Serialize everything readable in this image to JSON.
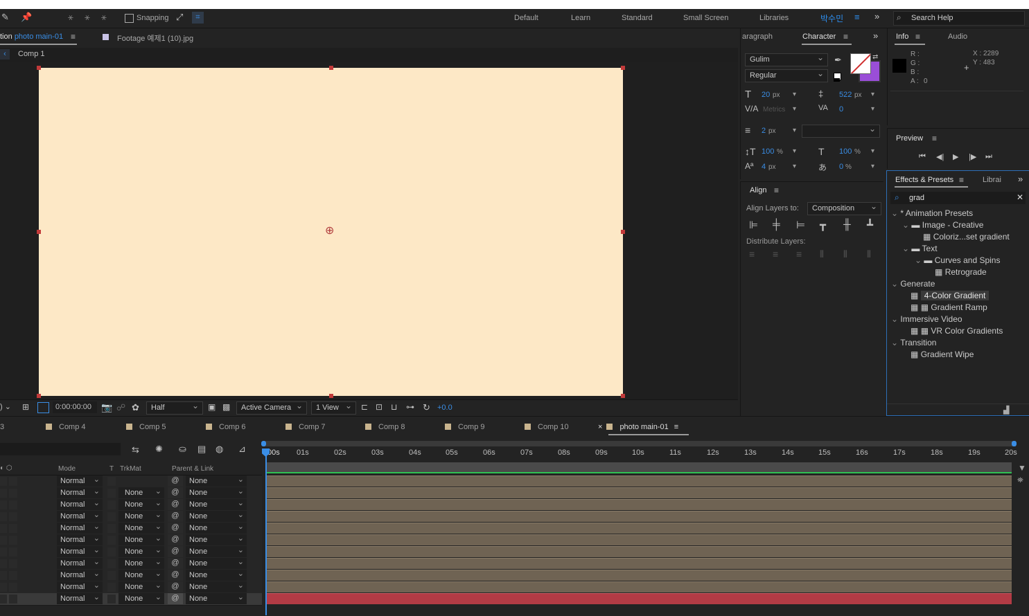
{
  "toolbar": {
    "snapping_label": "Snapping",
    "workspaces": [
      "Default",
      "Learn",
      "Standard",
      "Small Screen",
      "Libraries"
    ],
    "user_label": "박수민",
    "search_placeholder": "Search Help"
  },
  "comp_panel": {
    "tab_prefix": "tion",
    "tab_name": "photo main-01",
    "footage_tab": "Footage 예제1 (10).jpg",
    "breadcrumb": "Comp 1",
    "canvas_color": "#fde8c6",
    "footer": {
      "timecode": "0:00:00:00",
      "resolution": "Half",
      "camera": "Active Camera",
      "views": "1 View",
      "exposure": "+0.0"
    }
  },
  "character_panel": {
    "paragraph_tab": "aragraph",
    "character_tab": "Character",
    "font": "Gulim",
    "style": "Regular",
    "font_size": "20",
    "font_size_unit": "px",
    "leading": "522",
    "leading_unit": "px",
    "kerning": "Metrics",
    "tracking": "0",
    "stroke_width": "2",
    "stroke_unit": "px",
    "vert_scale": "100",
    "vert_unit": "%",
    "horiz_scale": "100",
    "horiz_unit": "%",
    "baseline": "4",
    "baseline_unit": "px",
    "tsume": "0",
    "tsume_unit": "%"
  },
  "align_panel": {
    "title": "Align",
    "align_to_label": "Align Layers to:",
    "align_to_value": "Composition",
    "distribute_label": "Distribute Layers:"
  },
  "info_panel": {
    "tabs": [
      "Info",
      "Audio"
    ],
    "r_label": "R :",
    "g_label": "G :",
    "b_label": "B :",
    "a_label": "A :",
    "a_value": "0",
    "x_label": "X : 2289",
    "y_label": "Y : 483"
  },
  "preview_panel": {
    "title": "Preview"
  },
  "effects_panel": {
    "tab": "Effects & Presets",
    "tab2": "Librai",
    "search_value": "grad",
    "items": [
      {
        "label": "* Animation Presets"
      },
      {
        "label": "Image - Creative"
      },
      {
        "label": "Coloriz...set gradient"
      },
      {
        "label": "Text"
      },
      {
        "label": "Curves and Spins"
      },
      {
        "label": "Retrograde"
      },
      {
        "label": "Generate"
      },
      {
        "label": "4-Color Gradient"
      },
      {
        "label": "Gradient Ramp"
      },
      {
        "label": "Immersive Video"
      },
      {
        "label": "VR Color Gradients"
      },
      {
        "label": "Transition"
      },
      {
        "label": "Gradient Wipe"
      }
    ]
  },
  "timeline": {
    "comp_tabs": [
      "3",
      "Comp 4",
      "Comp 5",
      "Comp 6",
      "Comp 7",
      "Comp 8",
      "Comp 9",
      "Comp 10",
      "photo main-01"
    ],
    "headers": {
      "mode": "Mode",
      "t": "T",
      "trkmat": "TrkMat",
      "parent": "Parent & Link"
    },
    "ruler": [
      "00s",
      "01s",
      "02s",
      "03s",
      "04s",
      "05s",
      "06s",
      "07s",
      "08s",
      "09s",
      "10s",
      "11s",
      "12s",
      "13s",
      "14s",
      "15s",
      "16s",
      "17s",
      "18s",
      "19s",
      "20s"
    ],
    "rows": [
      {
        "mode": "Normal",
        "trkmat": "",
        "parent": "None"
      },
      {
        "mode": "Normal",
        "trkmat": "None",
        "parent": "None"
      },
      {
        "mode": "Normal",
        "trkmat": "None",
        "parent": "None"
      },
      {
        "mode": "Normal",
        "trkmat": "None",
        "parent": "None"
      },
      {
        "mode": "Normal",
        "trkmat": "None",
        "parent": "None"
      },
      {
        "mode": "Normal",
        "trkmat": "None",
        "parent": "None"
      },
      {
        "mode": "Normal",
        "trkmat": "None",
        "parent": "None"
      },
      {
        "mode": "Normal",
        "trkmat": "None",
        "parent": "None"
      },
      {
        "mode": "Normal",
        "trkmat": "None",
        "parent": "None"
      },
      {
        "mode": "Normal",
        "trkmat": "None",
        "parent": "None"
      },
      {
        "mode": "Normal",
        "trkmat": "None",
        "parent": "None"
      }
    ],
    "track_color": "#6f6353",
    "selected_track_color": "#b33b45"
  }
}
